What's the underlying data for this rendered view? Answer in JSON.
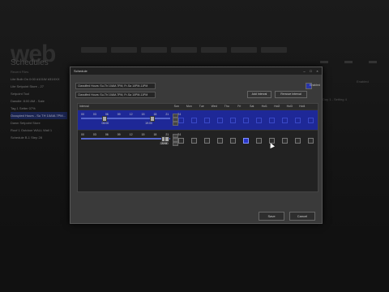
{
  "background": {
    "logo": "web",
    "title": "Schedules",
    "sidebar_header": "Recent Files",
    "sidebar_items": [
      "Lite Bulb On 0:00 #101W #31XXX",
      "Lite Setpoint Store - 27",
      "Setpoint Tool",
      "Dawdle: 8:00 AM - Sale",
      "Tag 1 Setter 07%",
      "Occupied Hours - Su TH 10AM-7PM...",
      "Dawn Setpoint Store",
      "Roof 1 Outdoor WALL Wall 1",
      "Schedule B-1 Step 28"
    ],
    "right_text": "Day 1 - Setting 4",
    "right_check": "Enabled"
  },
  "dialog": {
    "title": "Schedule",
    "controls": [
      "–",
      "□",
      "×"
    ],
    "field1": "Classified Hours: Su-Th 10AM-7PM, Fr-Sa 10PM-11PM",
    "field2": "Classified Hours: Su-Th 10AM-7PM, Fr-Sa 10PM-11PM",
    "enabled_label": "Enabled",
    "add_button": "Add Interval",
    "remove_button": "Remove Interval",
    "interval_header": "Interval",
    "days": [
      "Sun",
      "Mon",
      "Tue",
      "Wed",
      "Thu",
      "Fri",
      "Sat",
      "Hol1",
      "Hol2",
      "Hol3",
      "Hol4"
    ],
    "hour_ticks": [
      "00",
      "03",
      "06",
      "09",
      "12",
      "15",
      "18",
      "21",
      "24"
    ],
    "rows": [
      {
        "start": "06:00",
        "end": "19:00",
        "checked": [
          true,
          true,
          true,
          true,
          true,
          false,
          false,
          false,
          false,
          false,
          false
        ]
      },
      {
        "start": "22:00",
        "end": "23:00",
        "checked": [
          false,
          false,
          false,
          false,
          false,
          true,
          false,
          false,
          false,
          false,
          false
        ]
      }
    ],
    "save_button": "Save",
    "cancel_button": "Cancel"
  }
}
